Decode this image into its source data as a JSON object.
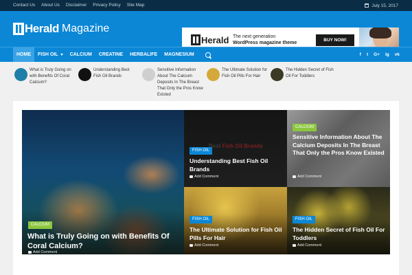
{
  "topbar": {
    "links": [
      "Contact Us",
      "About Us",
      "Disclaimer",
      "Privacy Policy",
      "Site Map"
    ],
    "date": "July 15, 2017"
  },
  "logo": {
    "part1": "Herald",
    "part2": "Magazine"
  },
  "ad": {
    "brand": "Herald",
    "tagline_1": "The next generation",
    "tagline_2": "WordPress magazine theme",
    "button": "BUY NOW!"
  },
  "nav": {
    "items": [
      {
        "label": "HOME",
        "active": true
      },
      {
        "label": "FISH OIL",
        "dropdown": true
      },
      {
        "label": "CALCIUM"
      },
      {
        "label": "CREATINE"
      },
      {
        "label": "HERBALIFE"
      },
      {
        "label": "MAGNESIUM"
      }
    ],
    "social": [
      "f",
      "t",
      "G+",
      "ig",
      "vk"
    ]
  },
  "ticker": [
    {
      "title": "What is Truly Going on with Benefits Of Coral Calcium?",
      "color": "#1f7fa8"
    },
    {
      "title": "Understanding Best Fish Oil Brands",
      "color": "#111111"
    },
    {
      "title": "Sensitive Information About The Calcium Deposits In The Breast That Only the Pros Know Existed",
      "color": "#cfcfcf"
    },
    {
      "title": "The Ultimate Solution for Fish Oil Pills For Hair",
      "color": "#d4a83a"
    },
    {
      "title": "The Hidden Secret of Fish Oil For Toddlers",
      "color": "#3b3a24"
    }
  ],
  "tiles": [
    {
      "category": "CALCIUM",
      "cat_color": "#8cc63f",
      "title": "What is Truly Going on with Benefits Of Coral Calcium?",
      "comment": "Add Comment"
    },
    {
      "category": "FISH OIL",
      "cat_color": "#0b87d6",
      "title": "Understanding Best Fish Oil Brands",
      "comment": "Add Comment",
      "bg_text_1": "Best",
      "bg_text_2": "Fish Oil Brands"
    },
    {
      "category": "CALCIUM",
      "cat_color": "#8cc63f",
      "title": "Sensitive Information About The Calcium Deposits In The Breast That Only the Pros Know Existed",
      "comment": "Add Comment"
    },
    {
      "category": "FISH OIL",
      "cat_color": "#0b87d6",
      "title": "The Ultimate Solution for Fish Oil Pills For Hair",
      "comment": "Add Comment"
    },
    {
      "category": "FISH OIL",
      "cat_color": "#0b87d6",
      "title": "The Hidden Secret of Fish Oil For Toddlers",
      "comment": "Add Comment"
    }
  ]
}
